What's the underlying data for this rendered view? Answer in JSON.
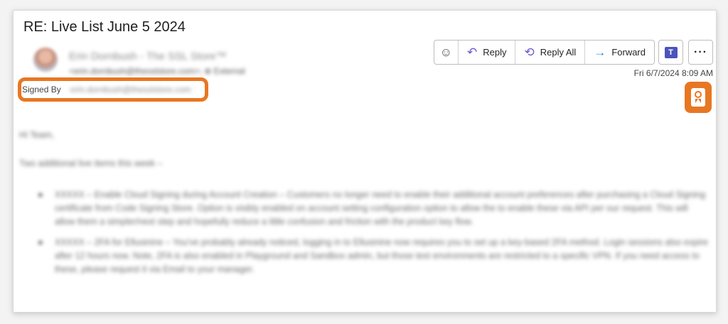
{
  "email": {
    "subject": "RE: Live List June 5 2024",
    "sender_name": "Erin Dornbush - The SSL Store™",
    "sender_address": "<erin.dornbush@thesslstore.com>; ⊕ External",
    "signed_by_label": "Signed By",
    "signed_by_email": "erin.dornbush@thesslstore.com",
    "date": "Fri 6/7/2024 8:09 AM"
  },
  "toolbar": {
    "reply_label": "Reply",
    "reply_all_label": "Reply All",
    "forward_label": "Forward"
  },
  "icons": {
    "emoji": "smiley-icon",
    "reply": "reply-arrow-icon",
    "reply_all": "reply-all-arrow-icon",
    "forward": "forward-arrow-icon",
    "teams": "microsoft-teams-icon",
    "more": "ellipsis-icon",
    "certificate": "certificate-ribbon-icon"
  },
  "colors": {
    "highlight": "#e87722",
    "teams": "#4b53bc",
    "reply_accent": "#6b5bd1",
    "forward_accent": "#2b88d8"
  },
  "body": {
    "greeting": "Hi Team,",
    "intro": "Two additional live items this week –",
    "bullets": [
      "XXXXX – Enable Cloud Signing during Account Creation – Customers no longer need to enable their additional account preferences after purchasing a Cloud Signing certificate from Code Signing Store. Option is visibly enabled on account setting configuration option to allow the to enable these via API per our request. This will allow them a simpler/next step and hopefully reduce a little confusion and friction with the product key flow.",
      "XXXXX – 2FA for Ellusinine – You've probably already noticed, logging in to Ellusinine now requires you to set up a key-based 2FA method. Login sessions also expire after 12 hours now. Note, 2FA is also enabled in Playground and Sandbox admin, but those test environments are restricted to a specific VPN. If you need access to these, please request it via Email to your manager."
    ]
  }
}
